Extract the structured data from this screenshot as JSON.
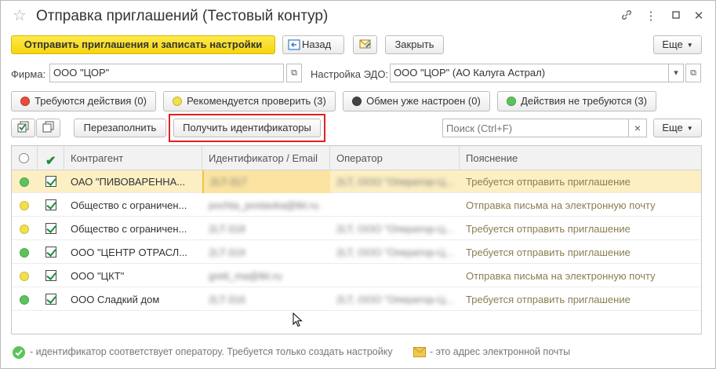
{
  "window": {
    "title": "Отправка приглашений (Тестовый контур)",
    "star_icon": "☆",
    "controls": [
      "link-icon",
      "more-icon",
      "maximize-icon",
      "close-icon"
    ]
  },
  "toolbar": {
    "send_label": "Отправить приглашения и записать настройки",
    "back_label": "Назад",
    "close_label": "Закрыть",
    "more_label": "Еще"
  },
  "firm": {
    "label": "Фирма:",
    "value": "ООО \"ЦОР\""
  },
  "edo": {
    "label": "Настройка ЭДО:",
    "value": "ООО \"ЦОР\" (АО Калуга Астрал)"
  },
  "filters": [
    {
      "label": "Требуются действия (0)",
      "color": "#e84c3d"
    },
    {
      "label": "Рекомендуется проверить (3)",
      "color": "#f1e04a"
    },
    {
      "label": "Обмен уже настроен (0)",
      "color": "#444444"
    },
    {
      "label": "Действия не требуются (3)",
      "color": "#5cc35a"
    }
  ],
  "actions": {
    "refill_label": "Перезаполнить",
    "get_ids_label": "Получить идентификаторы",
    "search_placeholder": "Поиск (Ctrl+F)",
    "clear_label": "×",
    "more_label": "Еще"
  },
  "table": {
    "headers": [
      "Контрагент",
      "Идентификатор / Email",
      "Оператор",
      "Пояснение"
    ],
    "rows": [
      {
        "status": "#5cc35a",
        "name": "ОАО \"ПИВОВАРЕННА...",
        "id": "2LT-317",
        "operator": "2LT, ООО \"Оператор-Ц...",
        "note": "Требуется отправить приглашение",
        "selected": true
      },
      {
        "status": "#f1e04a",
        "name": "Общество с ограничен...",
        "id": "pochta_postavka@tkt.ru",
        "operator": "",
        "note": "Отправка письма на электронную почту",
        "selected": false
      },
      {
        "status": "#f1e04a",
        "name": "Общество с ограничен...",
        "id": "2LT-318",
        "operator": "2LT, ООО \"Оператор-Ц...",
        "note": "Требуется отправить приглашение",
        "selected": false
      },
      {
        "status": "#5cc35a",
        "name": "ООО \"ЦЕНТР ОТРАСЛ...",
        "id": "2LT-319",
        "operator": "2LT, ООО \"Оператор-Ц...",
        "note": "Требуется отправить приглашение",
        "selected": false
      },
      {
        "status": "#f1e04a",
        "name": "ООО \"ЦКТ\"",
        "id": "grett_ma@tkt.ru",
        "operator": "",
        "note": "Отправка письма на электронную почту",
        "selected": false
      },
      {
        "status": "#5cc35a",
        "name": "ООО Сладкий дом",
        "id": "2LT-316",
        "operator": "2LT, ООО \"Оператор-Ц...",
        "note": "Требуется отправить приглашение",
        "selected": false
      }
    ]
  },
  "legend": {
    "ok_text": "- идентификатор соответствует оператору. Требуется только создать настройку",
    "mail_text": "- это адрес электронной почты"
  }
}
